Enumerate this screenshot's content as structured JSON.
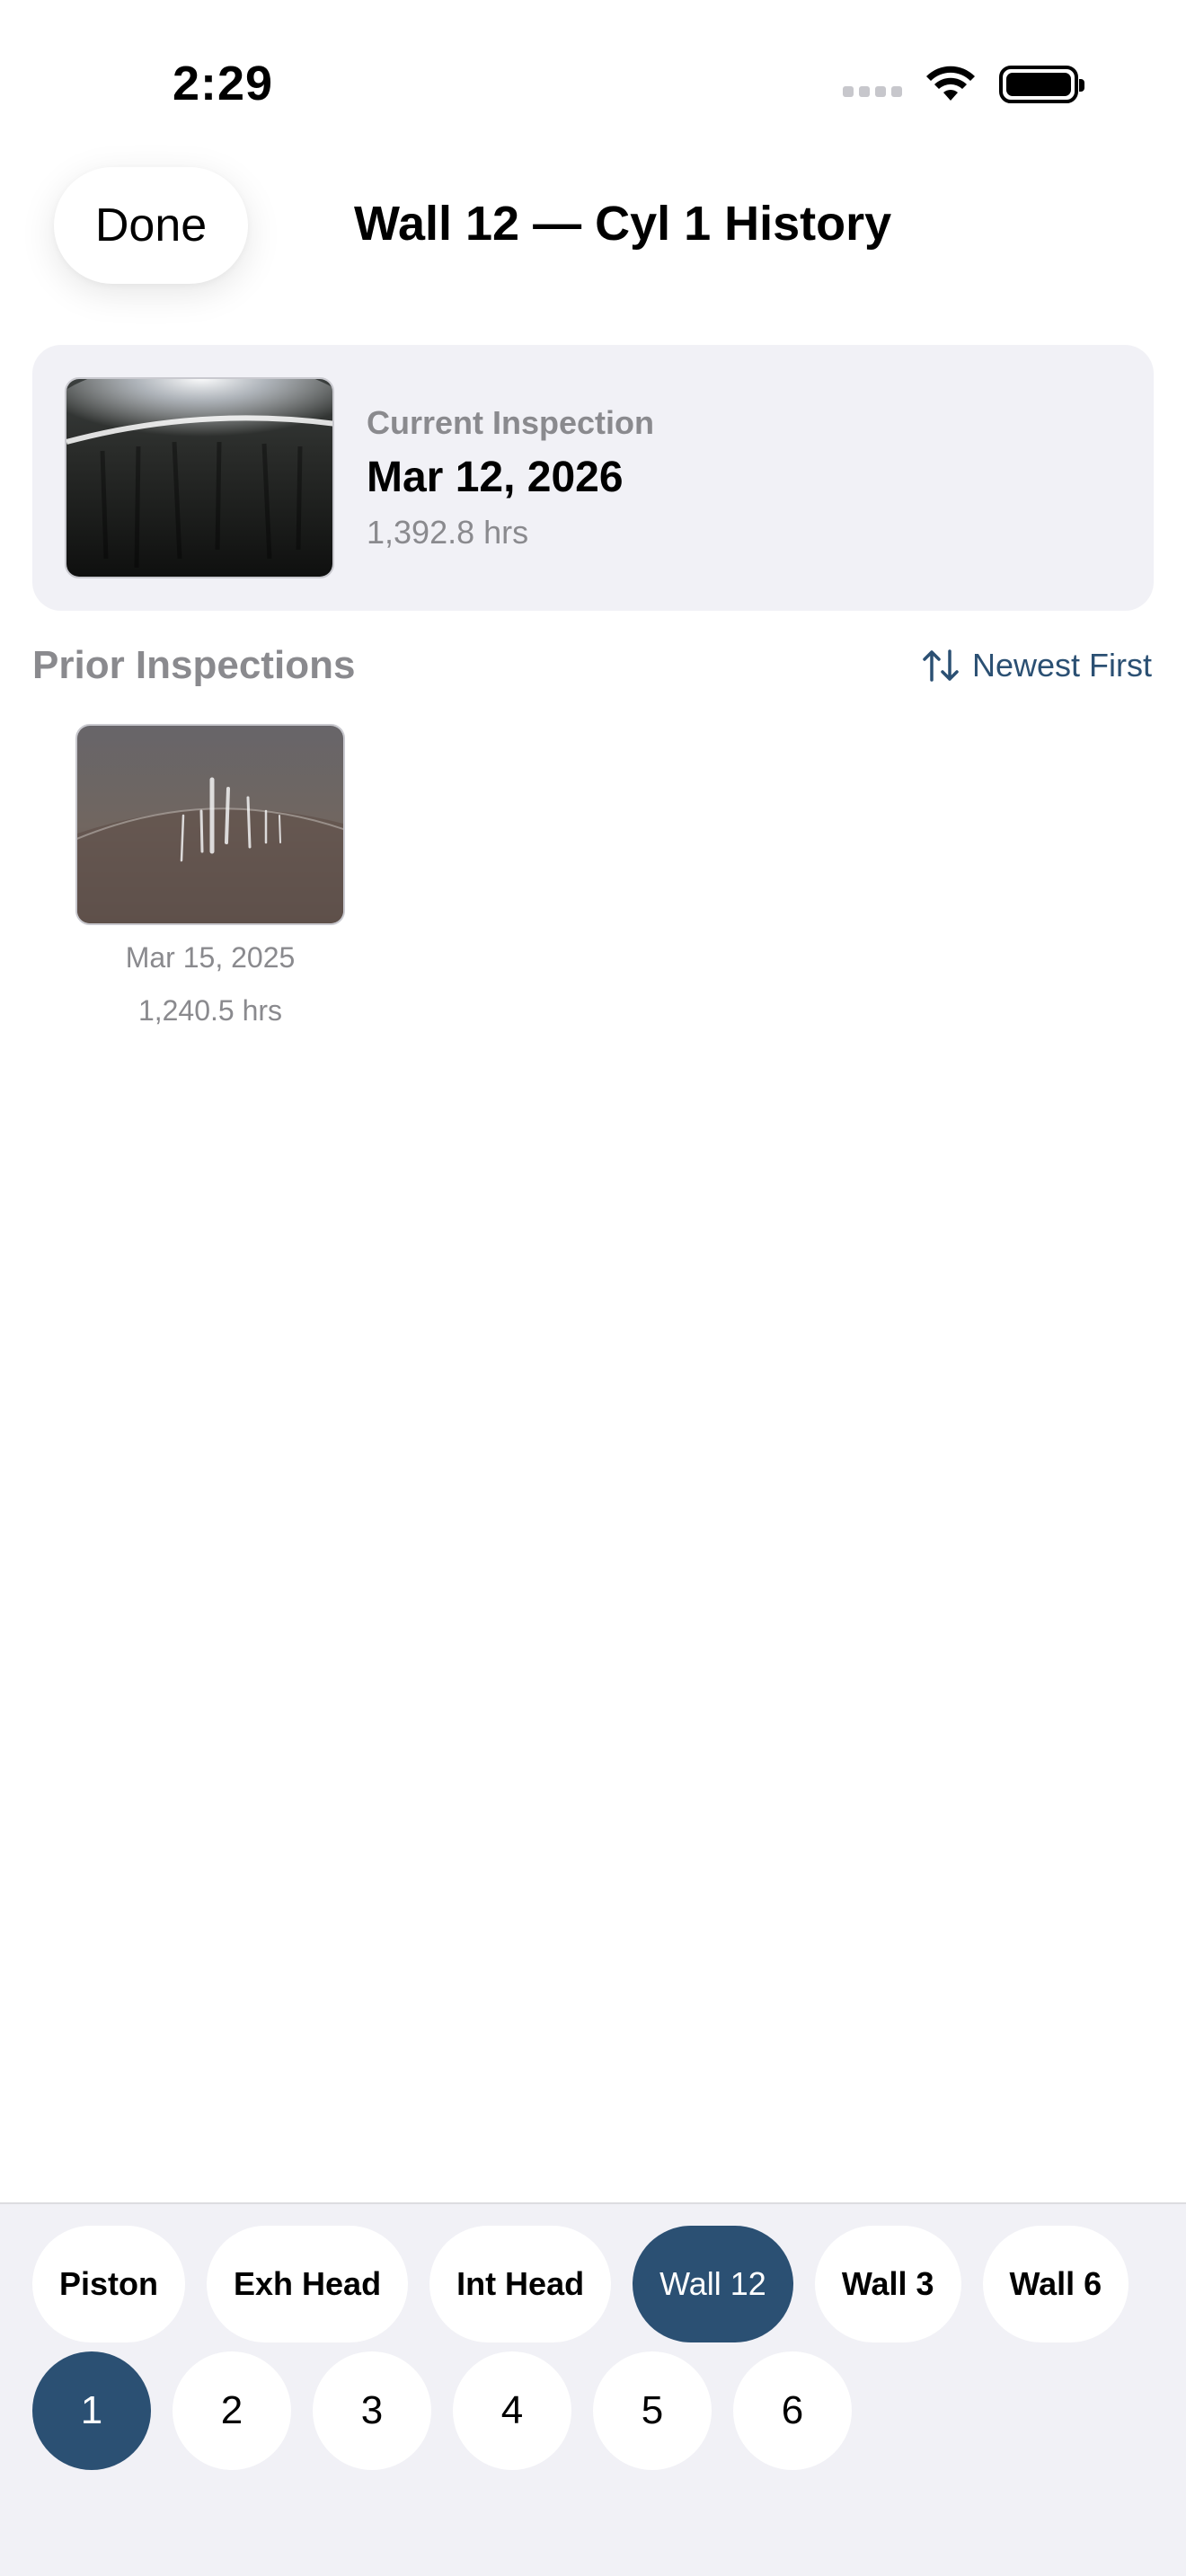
{
  "status_bar": {
    "time": "2:29"
  },
  "header": {
    "done_label": "Done",
    "title": "Wall 12 — Cyl 1 History"
  },
  "current": {
    "label": "Current Inspection",
    "date": "Mar 12, 2026",
    "hours": "1,392.8 hrs"
  },
  "prior": {
    "title": "Prior Inspections",
    "sort_label": "Newest First",
    "items": [
      {
        "date": "Mar 15, 2025",
        "hours": "1,240.5 hrs"
      }
    ]
  },
  "bottom": {
    "chips": [
      {
        "label": "Piston",
        "active": false
      },
      {
        "label": "Exh Head",
        "active": false
      },
      {
        "label": "Int Head",
        "active": false
      },
      {
        "label": "Wall 12",
        "active": true
      },
      {
        "label": "Wall 3",
        "active": false
      },
      {
        "label": "Wall 6",
        "active": false
      }
    ],
    "numbers": [
      {
        "label": "1",
        "active": true
      },
      {
        "label": "2",
        "active": false
      },
      {
        "label": "3",
        "active": false
      },
      {
        "label": "4",
        "active": false
      },
      {
        "label": "5",
        "active": false
      },
      {
        "label": "6",
        "active": false
      }
    ]
  },
  "colors": {
    "accent": "#2b5073",
    "card_bg": "#f1f1f6",
    "secondary_text": "#8a8a8e"
  },
  "icons": [
    "wifi-icon",
    "battery-icon",
    "sort-icon"
  ]
}
